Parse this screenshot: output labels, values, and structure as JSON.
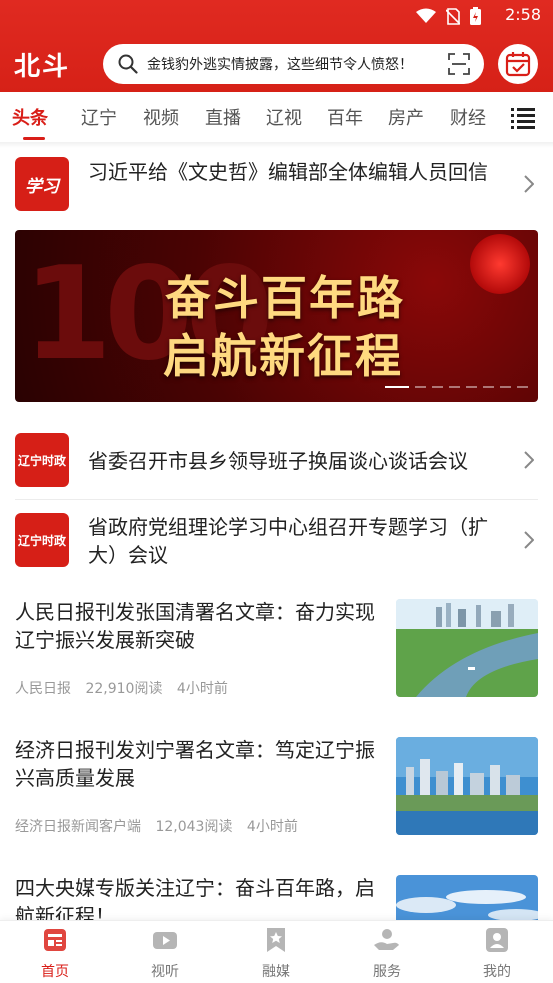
{
  "status_bar": {
    "time": "2:58"
  },
  "header": {
    "brand": "北斗",
    "search_text": "金钱豹外逃实情披露，这些细节令人愤怒！"
  },
  "tabs": [
    "头条",
    "辽宁",
    "视频",
    "直播",
    "辽视",
    "百年",
    "房产",
    "财经"
  ],
  "headlines": [
    {
      "logo_text": "学习",
      "title": "习近平给《文史哲》编辑部全体编辑人员回信"
    },
    {
      "logo_text": "辽宁时政",
      "title": "省委召开市县乡领导班子换届谈心谈话会议"
    },
    {
      "logo_text": "辽宁时政",
      "title": "省政府党组理论学习中心组召开专题学习（扩大）会议"
    }
  ],
  "banner": {
    "line1": "奋斗百年路",
    "line2": "启航新征程",
    "bg_number": "100",
    "slide_count": 8,
    "active_slide": 1
  },
  "news": [
    {
      "title": "人民日报刊发张国清署名文章：奋力实现辽宁振兴发展新突破",
      "source": "人民日报",
      "reads": "22,910阅读",
      "time": "4小时前"
    },
    {
      "title": "经济日报刊发刘宁署名文章：笃定辽宁振兴高质量发展",
      "source": "经济日报新闻客户端",
      "reads": "12,043阅读",
      "time": "4小时前"
    },
    {
      "title": "四大央媒专版关注辽宁：奋斗百年路，启航新征程！",
      "source": "",
      "reads": "",
      "time": ""
    }
  ],
  "bottom_nav": [
    {
      "label": "首页",
      "icon": "home-news-icon",
      "active": true
    },
    {
      "label": "视听",
      "icon": "video-icon",
      "active": false
    },
    {
      "label": "融媒",
      "icon": "bookmark-star-icon",
      "active": false
    },
    {
      "label": "服务",
      "icon": "hand-service-icon",
      "active": false
    },
    {
      "label": "我的",
      "icon": "profile-icon",
      "active": false
    }
  ],
  "colors": {
    "brand_red": "#d91e18",
    "meta_gray": "#999999"
  }
}
